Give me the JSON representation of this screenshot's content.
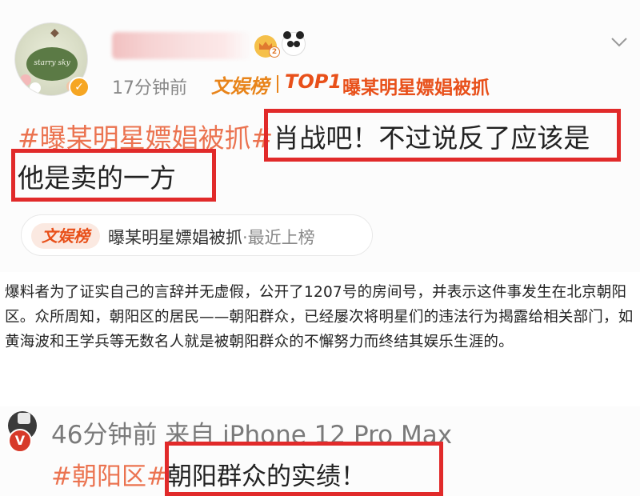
{
  "post1": {
    "avatar_text": "starry sky",
    "time": "17分钟前",
    "rank_source": "文娱榜",
    "rank": "TOP1",
    "trend_title": "曝某明星嫖娼被抓",
    "level": "2",
    "content": {
      "hashtag": "#曝某明星嫖娼被抓#",
      "line1_rest": "肖战吧！不过说反了应该是",
      "line2": "他是卖的一方"
    },
    "chip": {
      "logo": "文娱榜",
      "title": "曝某明星嫖娼被抓",
      "status": "·最近上榜"
    }
  },
  "article": {
    "text": "爆料者为了证实自己的言辞并无虚假，公开了1207号的房间号，并表示这件事发生在北京朝阳区。众所周知，朝阳区的居民——朝阳群众，已经屡次将明星们的违法行为揭露给相关部门，如黄海波和王学兵等无数名人就是被朝阳群众的不懈努力而终结其娱乐生涯的。"
  },
  "post2": {
    "verified": "V",
    "time_source": "46分钟前  来自 iPhone 12 Pro Max",
    "hashtag": "#朝阳区#",
    "content": "朝阳群众的实绩！"
  },
  "colors": {
    "highlight_box": "#e12a2a",
    "hashtag": "#eb7350",
    "rank_orange": "#e8841a",
    "rank_red": "#e8501a"
  }
}
